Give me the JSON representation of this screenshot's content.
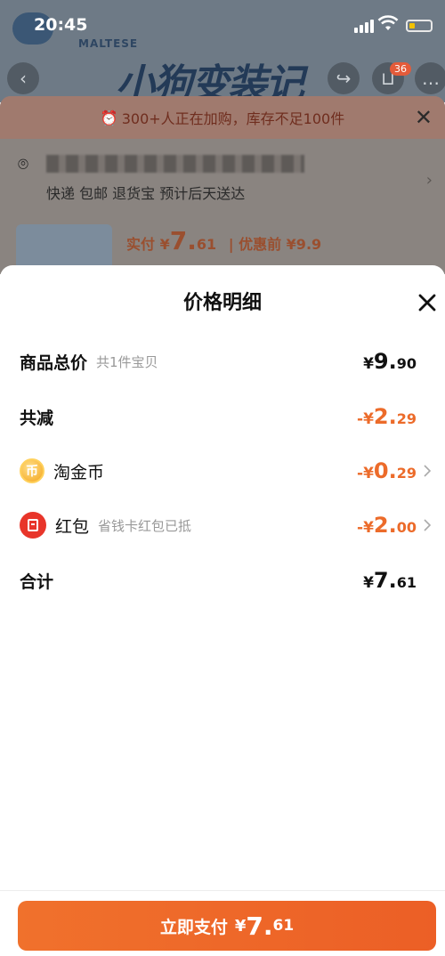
{
  "status_bar": {
    "time": "20:45"
  },
  "background": {
    "brand": "MALTESE",
    "banner_title": "小狗变装记",
    "cart_count": "36",
    "stock_warning": "300+人正在加购，库存不足100件",
    "shipping": "快递 包邮 退货宝 预计后天送达",
    "price_prefix": "实付 ¥",
    "price_int": "7.",
    "price_dec": "61",
    "price_original": "| 优惠前 ¥9.9"
  },
  "sheet": {
    "title": "价格明细",
    "rows": [
      {
        "label": "商品总价",
        "sub": "共1件宝贝",
        "currency": "¥",
        "int": "9.",
        "dec": "90"
      },
      {
        "label": "共减",
        "currency": "-¥",
        "int": "2.",
        "dec": "29"
      },
      {
        "label": "淘金币",
        "icon_glyph": "币",
        "currency": "-¥",
        "int": "0.",
        "dec": "29"
      },
      {
        "label": "红包",
        "sub": "省钱卡红包已抵",
        "currency": "-¥",
        "int": "2.",
        "dec": "00"
      },
      {
        "label": "合计",
        "currency": "¥",
        "int": "7.",
        "dec": "61"
      }
    ]
  },
  "pay_button": {
    "label": "立即支付",
    "currency": "¥",
    "int": "7.",
    "dec": "61"
  },
  "colors": {
    "accent": "#ec6b2a",
    "pay_button": "#ec5f26",
    "red_packet": "#e8352a",
    "coin": "#f4a41a"
  },
  "icons": [
    "back-icon",
    "share-icon",
    "cart-icon",
    "more-icon",
    "alarm-icon",
    "close-icon",
    "location-icon",
    "coin-icon",
    "red-packet-icon",
    "chevron-right-icon"
  ]
}
